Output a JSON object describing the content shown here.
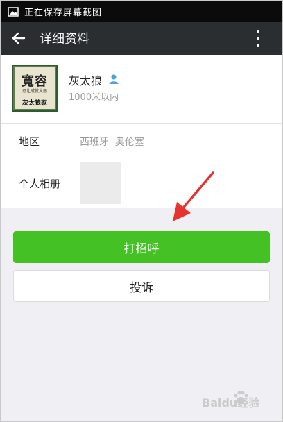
{
  "status_bar": {
    "text": "正在保存屏幕截图",
    "icon": "image-icon"
  },
  "header": {
    "title": "详细资料",
    "back_icon": "back-arrow-icon",
    "more_icon": "more-vertical-icon"
  },
  "profile": {
    "name": "灰太狼",
    "distance": "1000米以内",
    "avatar_big_text": "寬容",
    "avatar_small_text": "忍让成就大器",
    "avatar_bottom_text": "灰太狼家",
    "person_icon": "person-icon"
  },
  "details": {
    "region_label": "地区",
    "region_value": "西班牙  奥伦塞",
    "album_label": "个人相册"
  },
  "actions": {
    "greet_label": "打招呼",
    "report_label": "投诉"
  },
  "watermark": {
    "text": "Baidu经验"
  },
  "colors": {
    "primary_green": "#44c124",
    "appbar": "#2a2e31",
    "arrow_red": "#e8322f"
  }
}
